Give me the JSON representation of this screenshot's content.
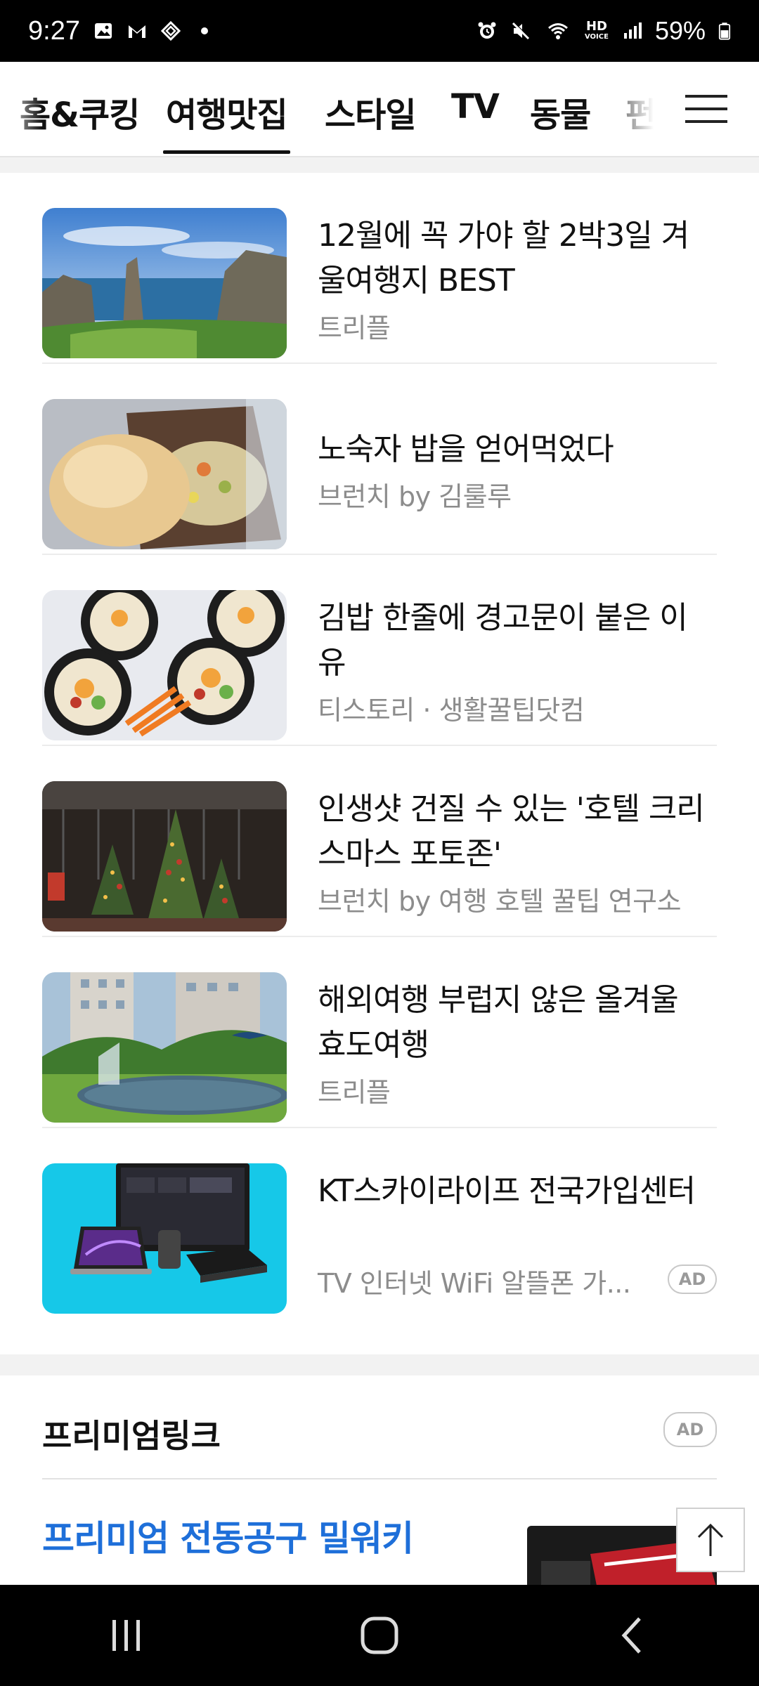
{
  "status_bar": {
    "time": "9:27",
    "hd_label": "HD",
    "voice_label": "VOICE",
    "battery": "59%",
    "icons": [
      "gallery-icon",
      "gmail-icon",
      "app-icon",
      "dot-icon",
      "alarm-icon",
      "mute-icon",
      "wifi-icon",
      "signal-icon",
      "battery-icon"
    ]
  },
  "tabs": [
    {
      "label": "홈&쿠킹"
    },
    {
      "label": "여행맛집",
      "active": true
    },
    {
      "label": "스타일"
    },
    {
      "label": "TV"
    },
    {
      "label": "동물"
    },
    {
      "label": "펀"
    }
  ],
  "articles": [
    {
      "title": "12월에 꼭 가야 할 2박3일 겨울여행지 BEST",
      "source": "트리플",
      "thumb": "coastal-rocks"
    },
    {
      "title": "노숙자 밥을 얻어먹었다",
      "source": "브런치 by 김룰루",
      "thumb": "bread-meal"
    },
    {
      "title": "김밥 한줄에 경고문이 붙은 이유",
      "source": "티스토리 · 생활꿀팁닷컴",
      "thumb": "kimbap"
    },
    {
      "title": "인생샷 건질 수 있는 '호텔 크리스마스 포토존'",
      "source": "브런치 by 여행 호텔 꿀팁 연구소",
      "thumb": "christmas-trees"
    },
    {
      "title": "해외여행 부럽지 않은 올겨울 효도여행",
      "source": "트리플",
      "thumb": "garden"
    },
    {
      "title": "KT스카이라이프 전국가입센터",
      "source": "TV 인터넷 WiFi 알뜰폰 가...",
      "thumb": "devices-ad",
      "ad_label": "AD"
    }
  ],
  "premium": {
    "title": "프리미엄링크",
    "ad_label": "AD",
    "link_text": "프리미엄 전동공구 밀워키"
  },
  "colors": {
    "link_blue": "#1e6fd9",
    "source_gray": "#8c8c8c",
    "ad_thumb_cyan": "#16c8e8"
  }
}
